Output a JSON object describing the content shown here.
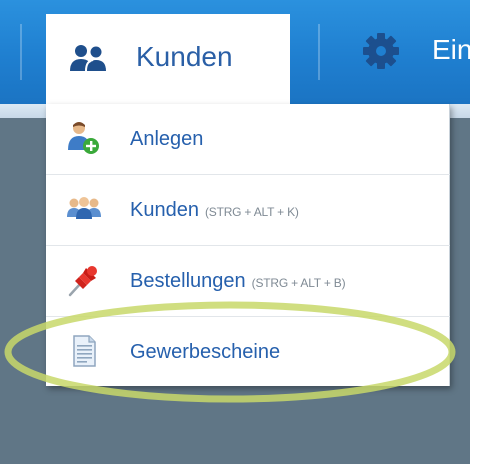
{
  "nav": {
    "active_tab": {
      "label": "Kunden",
      "icon": "users-icon"
    },
    "next_tab": {
      "label": "Einstellungen",
      "icon": "gear-icon"
    }
  },
  "dropdown": {
    "items": [
      {
        "label": "Anlegen",
        "shortcut": "",
        "icon": "add-user-icon"
      },
      {
        "label": "Kunden",
        "shortcut": "(STRG + ALT + K)",
        "icon": "customers-group-icon"
      },
      {
        "label": "Bestellungen",
        "shortcut": "(STRG + ALT + B)",
        "icon": "pushpin-icon"
      },
      {
        "label": "Gewerbescheine",
        "shortcut": "",
        "icon": "document-icon"
      }
    ]
  },
  "colors": {
    "topbar": "#1f7fd0",
    "link": "#2660ad",
    "backdrop": "#607686",
    "highlight": "#c8d86a"
  }
}
